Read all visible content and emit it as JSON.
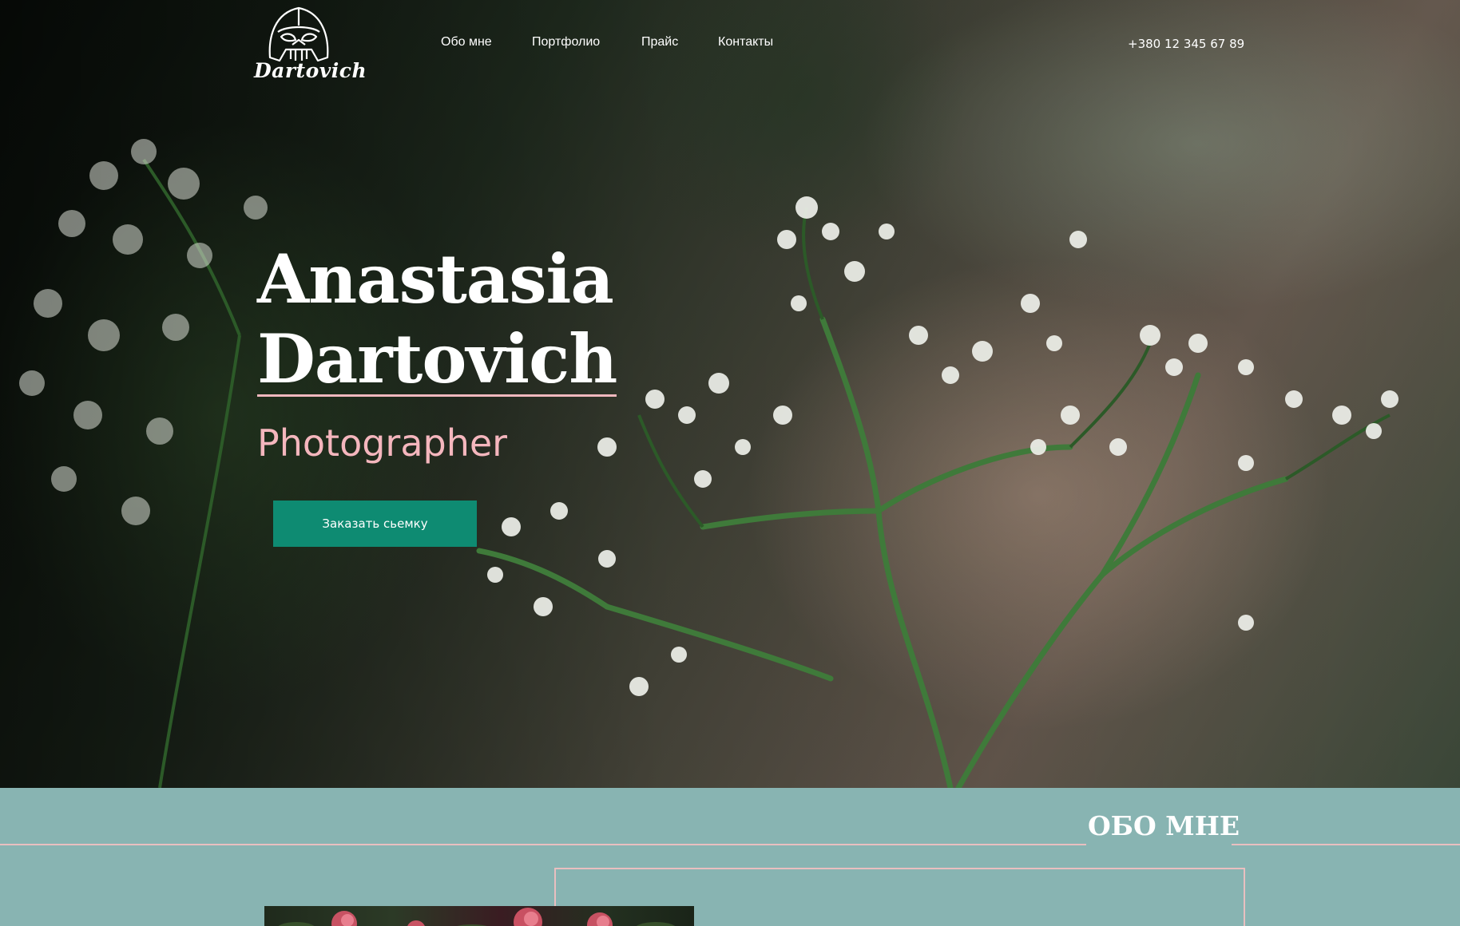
{
  "header": {
    "logo_text": "Dartovich",
    "nav": [
      {
        "label": "Обо мне"
      },
      {
        "label": "Портфолио"
      },
      {
        "label": "Прайс"
      },
      {
        "label": "Контакты"
      }
    ],
    "phone": "+380 12 345 67 89"
  },
  "hero": {
    "title_line1": "Anastasia",
    "title_line2": "Dartovich",
    "subtitle": "Photographer",
    "cta_label": "Заказать сьемку"
  },
  "about": {
    "title": "ОБО МНЕ"
  },
  "colors": {
    "accent_green": "#0e8b72",
    "accent_pink": "#f4b6bd",
    "about_bg": "#88b4b2"
  },
  "icons": [
    "darth-vader-helmet-icon"
  ]
}
